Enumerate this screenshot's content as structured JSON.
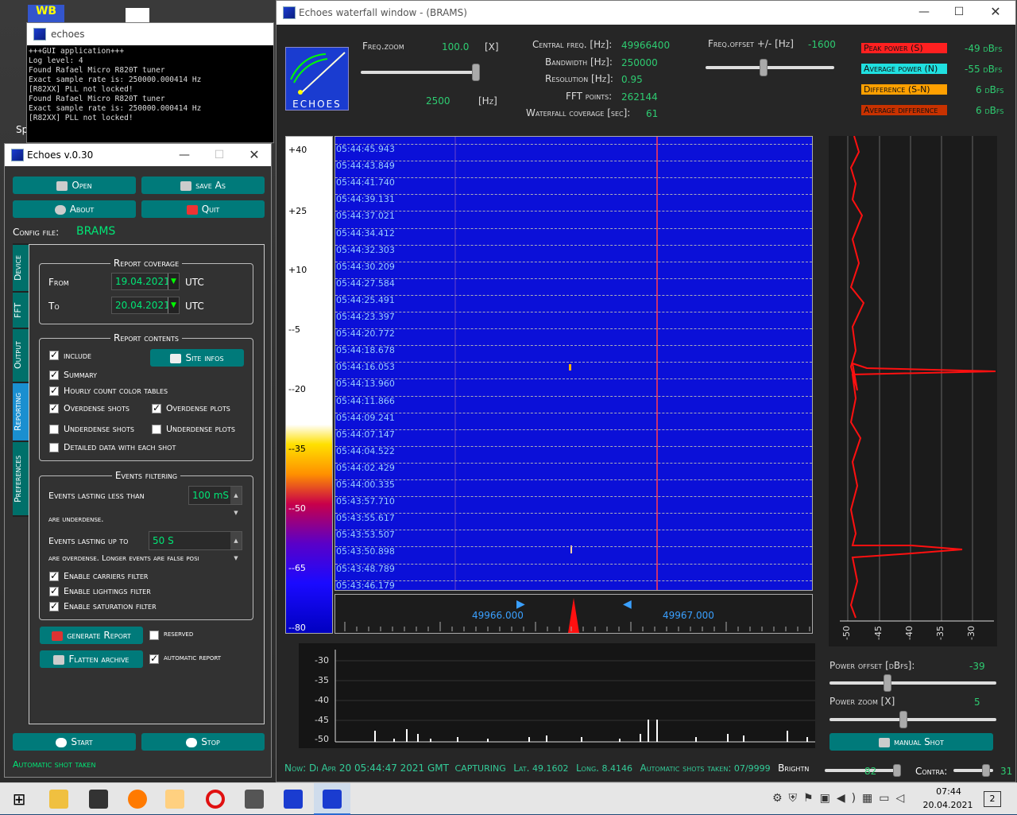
{
  "console": {
    "title": "echoes",
    "lines": [
      "+++GUI application+++",
      "Log level: 4",
      "Found Rafael Micro R820T tuner",
      "Exact sample rate is: 250000.000414 Hz",
      "[R82XX] PLL not locked!",
      "Found Rafael Micro R820T tuner",
      "Exact sample rate is: 250000.000414 Hz",
      "[R82XX] PLL not locked!"
    ]
  },
  "main": {
    "title": "Echoes v.0.30",
    "buttons": {
      "open": "Open",
      "save_as": "save As",
      "about": "About",
      "quit": "Quit",
      "start": "Start",
      "stop": "Stop",
      "generate": "generate Report",
      "flatten": "Flatten archive"
    },
    "config_label": "Config file:",
    "config_value": "BRAMS",
    "tabs": [
      "Device",
      "FFT",
      "Output",
      "Reporting",
      "Preferences"
    ],
    "coverage": {
      "title": "Report coverage",
      "from_label": "From",
      "from_value": "19.04.2021",
      "to_label": "To",
      "to_value": "20.04.2021",
      "tz": "UTC"
    },
    "contents": {
      "title": "Report contents",
      "include": "include",
      "site_infos": "Site infos",
      "summary": "Summary",
      "hourly": "Hourly count color tables",
      "over_shots": "Overdense shots",
      "over_plots": "Overdense plots",
      "under_shots": "Underdense shots",
      "under_plots": "Underdense plots",
      "detailed": "Detailed data with each shot"
    },
    "filtering": {
      "title": "Events filtering",
      "less_label": "Events lasting less than",
      "less_value": "100 mS",
      "underdense": "are underdense.",
      "upto_label": "Events lasting up to",
      "upto_value": "50 S",
      "overdense": "are overdense. Longer events are false posi",
      "carriers": "Enable carriers filter",
      "lightings": "Enable lightings filter",
      "saturation": "Enable saturation filter"
    },
    "reserved": "reserved",
    "automatic_report": "automatic report",
    "status": "Automatic shot taken"
  },
  "wf": {
    "title": "Echoes waterfall window - (BRAMS)",
    "logo_text": "ECHOES",
    "freq_zoom_label": "Freq.zoom",
    "freq_zoom_value": "100.0",
    "freq_zoom_unit": "[X]",
    "bw_value": "2500",
    "bw_unit": "[Hz]",
    "central_label": "Central freq. [Hz]:",
    "central_value": "49966400",
    "bandwidth_label": "Bandwidth [Hz]:",
    "bandwidth_value": "250000",
    "resolution_label": "Resolution [Hz]:",
    "resolution_value": "0.95",
    "fft_label": "FFT points:",
    "fft_value": "262144",
    "coverage_label": "Waterfall coverage [sec]:",
    "coverage_value": "61",
    "offset_label": "Freq.offset +/- [Hz]",
    "offset_value": "-1600",
    "badges": [
      {
        "label": "Peak power (S)",
        "value": "-49 dBfs",
        "color": "#ff2020"
      },
      {
        "label": "Average power (N)",
        "value": "-55 dBfs",
        "color": "#20e0e0"
      },
      {
        "label": "Difference (S-N)",
        "value": "6 dBfs",
        "color": "#ffa000"
      },
      {
        "label": "Average difference",
        "value": "6 dBfs",
        "color": "#c83200"
      }
    ],
    "scale_labels": [
      "+40",
      "+25",
      "+10",
      "--5",
      "--20",
      "--35",
      "--50",
      "--65",
      "--80"
    ],
    "timestamps": [
      "05:44:45.943",
      "05:44:43.849",
      "05:44:41.740",
      "05:44:39.131",
      "05:44:37.021",
      "05:44:34.412",
      "05:44:32.303",
      "05:44:30.209",
      "05:44:27.584",
      "05:44:25.491",
      "05:44:23.397",
      "05:44:20.772",
      "05:44:18.678",
      "05:44:16.053",
      "05:44:13.960",
      "05:44:11.866",
      "05:44:09.241",
      "05:44:07.147",
      "05:44:04.522",
      "05:44:02.429",
      "05:44:00.335",
      "05:43:57.710",
      "05:43:55.617",
      "05:43:53.507",
      "05:43:50.898",
      "05:43:48.789",
      "05:43:46.179"
    ],
    "ruler_labels": [
      "49966.000",
      "49967.000"
    ],
    "power_axis": [
      "-50",
      "-45",
      "-40",
      "-35",
      "-30"
    ],
    "spec_axis": [
      "-30",
      "-35",
      "-40",
      "-45",
      "-50"
    ],
    "power_offset_label": "Power offset [dBfs]:",
    "power_offset_value": "-39",
    "power_zoom_label": "Power zoom [X]",
    "power_zoom_value": "5",
    "manual_shot": "manual Shot",
    "status": {
      "now": "Now: Di Apr 20 05:44:47 2021 GMT",
      "capturing": "CAPTURING",
      "lat_label": "Lat.",
      "lat": "49.1602",
      "long_label": "Long.",
      "long": "8.4146",
      "shots_label": "Automatic shots taken:",
      "shots": "07/9999",
      "bright_label": "Brightn",
      "bright": "82",
      "contrast_label": "Contra:",
      "contrast": "31"
    }
  },
  "taskbar": {
    "time": "07:44",
    "date": "20.04.2021",
    "notif": "2"
  }
}
